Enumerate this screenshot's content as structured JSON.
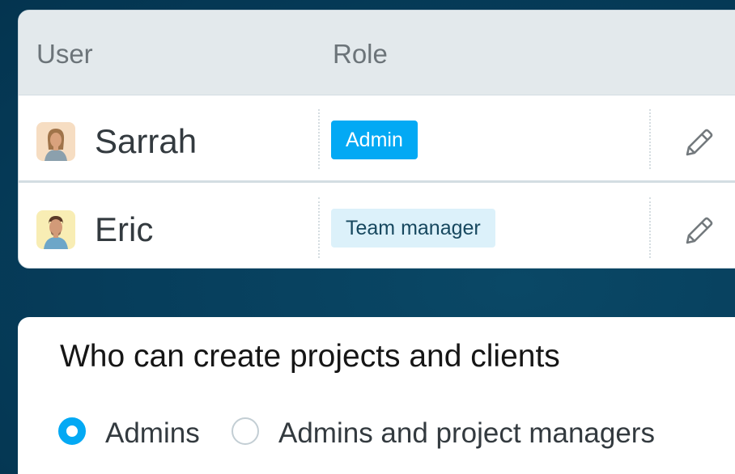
{
  "users_table": {
    "columns": {
      "user": "User",
      "role": "Role"
    },
    "rows": [
      {
        "name": "Sarrah",
        "role": "Admin",
        "role_style": "primary",
        "avatar": "woman-avatar-icon"
      },
      {
        "name": "Eric",
        "role": "Team manager",
        "role_style": "secondary",
        "avatar": "man-avatar-icon"
      }
    ],
    "edit_icon": "pencil-icon"
  },
  "permissions": {
    "title": "Who can create projects and clients",
    "options": [
      {
        "label": "Admins",
        "checked": true
      },
      {
        "label": "Admins and project managers",
        "checked": false
      }
    ]
  },
  "colors": {
    "background": "#063c5a",
    "accent": "#03a9f4",
    "badge_secondary": "#dcf1fa"
  }
}
